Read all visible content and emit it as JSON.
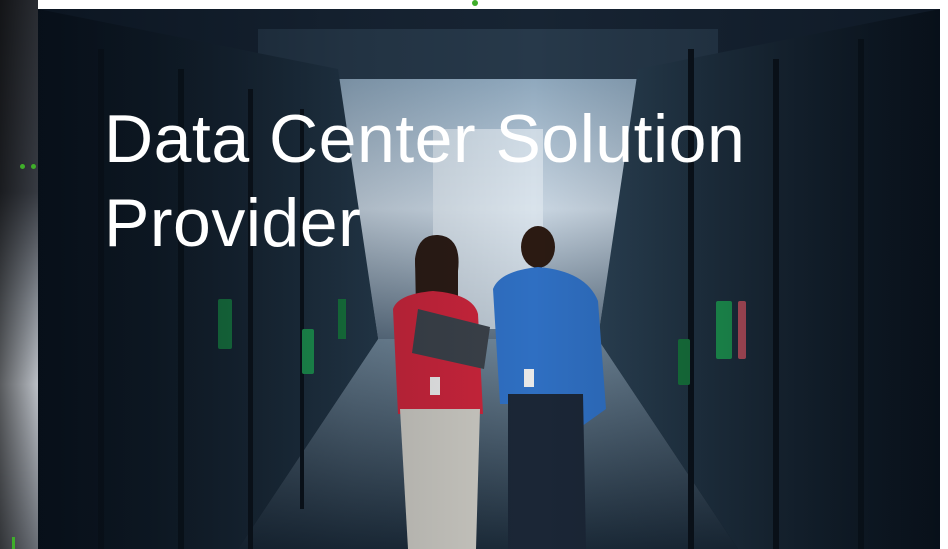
{
  "hero": {
    "title": "Data Center Solution Provider"
  },
  "image": {
    "subject": "two-people-walking-server-aisle-photo"
  },
  "colors": {
    "accent": "#3fae2a",
    "title_text": "#ffffff",
    "hero_bg": "#0d1722"
  }
}
